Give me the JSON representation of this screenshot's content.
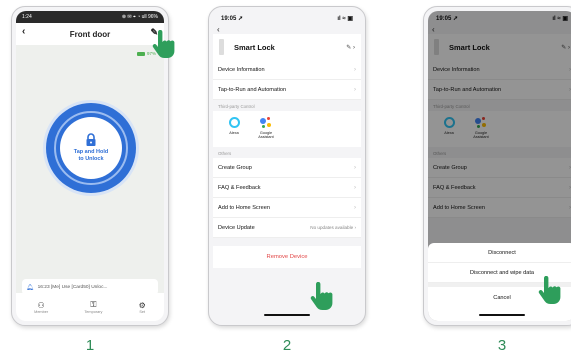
{
  "phone1": {
    "status": {
      "time": "1:24",
      "right": "⊗ ✉ ⌖ ◔ ull 96%"
    },
    "title": "Front door",
    "back_icon": "chevron-left",
    "edit_icon": "pencil",
    "battery": "97%",
    "unlock": {
      "line1": "Tap and Hold",
      "line2": "to Unlock"
    },
    "log": "16:23  [Me]  Use  [Card50]  Unloc...",
    "tabs": [
      {
        "label": "Member",
        "icon": "members-icon"
      },
      {
        "label": "Temporary",
        "icon": "key-icon"
      },
      {
        "label": "Set",
        "icon": "settings-icon"
      }
    ]
  },
  "phone2": {
    "status": {
      "time": "19:05 ➚",
      "right": "ıl ≈ ▣"
    },
    "device_name": "Smart Lock",
    "rows_top": [
      {
        "label": "Device Information"
      },
      {
        "label": "Tap-to-Run and Automation"
      }
    ],
    "section_third": "Third-party Control",
    "services": [
      {
        "label": "Alexa"
      },
      {
        "label": "Google Assistant"
      }
    ],
    "section_others": "Others",
    "rows_others": [
      {
        "label": "Create Group"
      },
      {
        "label": "FAQ & Feedback"
      },
      {
        "label": "Add to Home Screen"
      }
    ],
    "update": {
      "label": "Device Update",
      "value": "No updates available"
    },
    "remove": "Remove Device"
  },
  "phone3": {
    "status": {
      "time": "19:05 ➚",
      "right": "ıl ≈ ▣"
    },
    "device_name": "Smart Lock",
    "rows_top": [
      {
        "label": "Device Information"
      },
      {
        "label": "Tap-to-Run and Automation"
      }
    ],
    "section_third": "Third-party Control",
    "services": [
      {
        "label": "Alexa"
      },
      {
        "label": "Google Assistant"
      }
    ],
    "section_others": "Others",
    "rows_others": [
      {
        "label": "Create Group"
      },
      {
        "label": "FAQ & Feedback"
      },
      {
        "label": "Add to Home Screen"
      }
    ],
    "sheet": {
      "disconnect": "Disconnect",
      "wipe": "Disconnect and wipe data",
      "cancel": "Cancel"
    }
  },
  "steps": [
    "1",
    "2",
    "3"
  ],
  "colors": {
    "accent": "#2f6fd6",
    "danger": "#e24545",
    "hand": "#2e9e5b",
    "step": "#2e8b57"
  }
}
